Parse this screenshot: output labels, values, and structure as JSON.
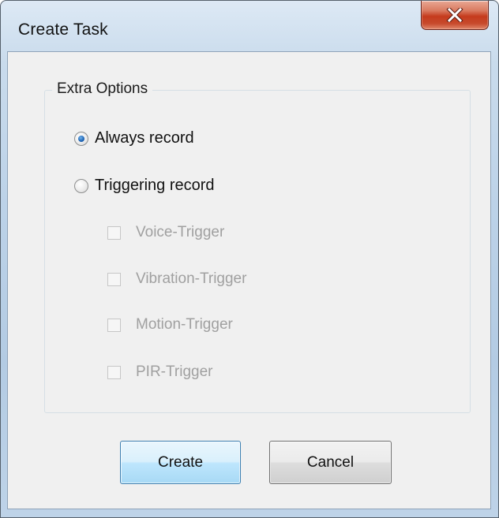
{
  "window": {
    "title": "Create Task",
    "close_icon": "close-x-icon"
  },
  "group": {
    "title": "Extra Options",
    "radios": [
      {
        "label": "Always record",
        "checked": true
      },
      {
        "label": "Triggering record",
        "checked": false
      }
    ],
    "checkboxes": [
      {
        "label": "Voice-Trigger",
        "checked": false,
        "enabled": false
      },
      {
        "label": "Vibration-Trigger",
        "checked": false,
        "enabled": false
      },
      {
        "label": "Motion-Trigger",
        "checked": false,
        "enabled": false
      },
      {
        "label": "PIR-Trigger",
        "checked": false,
        "enabled": false
      }
    ]
  },
  "buttons": {
    "create_label": "Create",
    "cancel_label": "Cancel"
  },
  "colors": {
    "close_button": "#c53b1d",
    "default_button_border": "#3c7fb1",
    "radio_dot": "#1f63b3",
    "disabled_text": "#a0a0a0"
  }
}
